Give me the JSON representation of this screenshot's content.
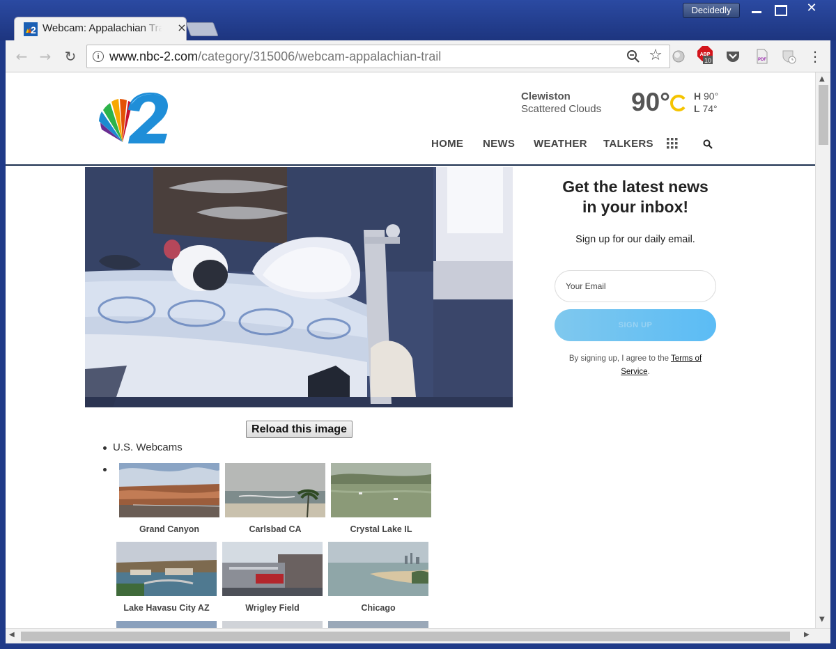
{
  "browser": {
    "tab_title": "Webcam: Appalachian Trail",
    "tab_close": "×",
    "profile_name": "Decidedly",
    "window_close": "✕",
    "url_domain": "www.nbc-2.com",
    "url_path": "/category/315006/webcam-appalachian-trail",
    "abp_count": "10",
    "icons": [
      "back-arrow-icon",
      "forward-arrow-icon",
      "reload-icon",
      "info-icon",
      "zoom-out-icon",
      "star-icon",
      "adblock-icon",
      "pocket-icon",
      "pdf-icon",
      "shield-icon",
      "menu-icon"
    ]
  },
  "header": {
    "weather": {
      "city": "Clewiston",
      "condition": "Scattered Clouds",
      "temp": "90°",
      "hi_label": "H",
      "hi": "90°",
      "lo_label": "L",
      "lo": "74°"
    },
    "nav": [
      "HOME",
      "NEWS",
      "WEATHER",
      "TALKERS"
    ]
  },
  "main": {
    "reload_label": "Reload this image",
    "list_heading": "U.S. Webcams",
    "webcams": [
      {
        "label": "Grand Canyon"
      },
      {
        "label": "Carlsbad CA"
      },
      {
        "label": "Crystal Lake IL"
      },
      {
        "label": "Lake Havasu City AZ"
      },
      {
        "label": "Wrigley Field"
      },
      {
        "label": "Chicago"
      }
    ]
  },
  "newsletter": {
    "title_line1": "Get the latest news",
    "title_line2": "in your inbox!",
    "subtitle": "Sign up for our daily email.",
    "email_placeholder": "Your Email",
    "signup_label": "SIGN UP",
    "terms_prefix": "By signing up, I agree to the ",
    "terms_link": "Terms of Service",
    "terms_suffix": "."
  },
  "colors": {
    "window_frame": "#1f3a88",
    "nav_text": "#444444",
    "signup_button": "#5bbcf5",
    "header_rule": "#1c2f4e"
  }
}
